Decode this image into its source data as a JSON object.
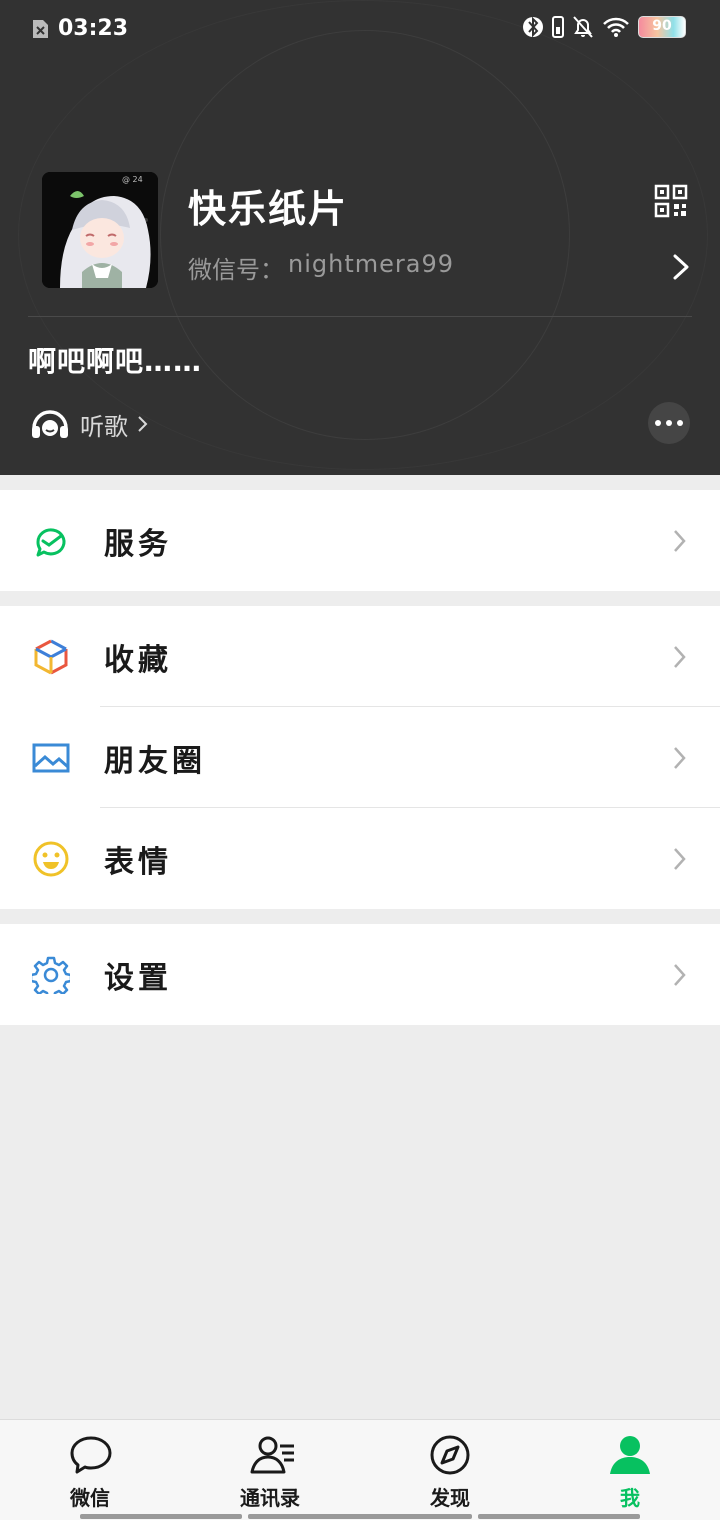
{
  "status_bar": {
    "time": "03:23",
    "battery": "90"
  },
  "profile": {
    "nickname": "快乐纸片",
    "wechat_id_label": "微信号：",
    "wechat_id": "nightmera99",
    "status": "啊吧啊吧……",
    "listen_label": "听歌"
  },
  "menu": {
    "services": "服务",
    "favorites": "收藏",
    "moments": "朋友圈",
    "stickers": "表情",
    "settings": "设置"
  },
  "tabs": [
    {
      "label": "微信",
      "icon": "chat-bubble-icon"
    },
    {
      "label": "通讯录",
      "icon": "contacts-icon"
    },
    {
      "label": "发现",
      "icon": "compass-icon"
    },
    {
      "label": "我",
      "icon": "person-icon",
      "active": true
    }
  ],
  "colors": {
    "accent": "#07c160",
    "header_bg": "#323232",
    "page_bg": "#ededed"
  }
}
